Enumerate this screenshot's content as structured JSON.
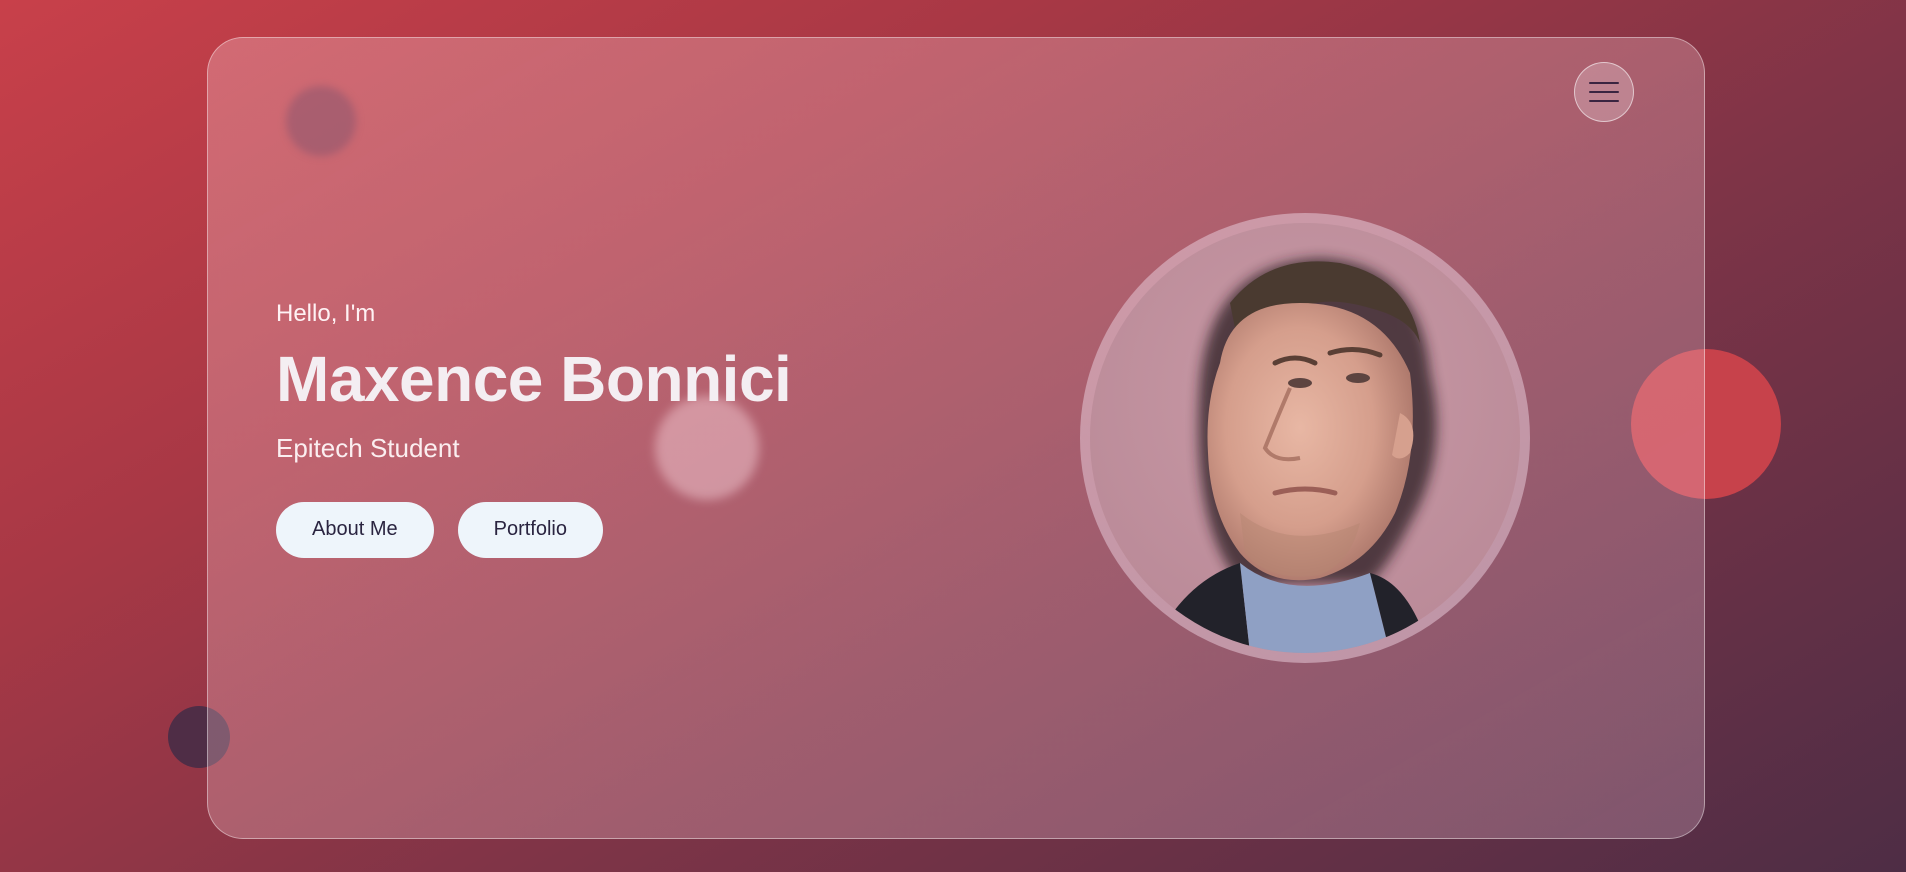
{
  "hero": {
    "greeting": "Hello, I'm",
    "name": "Maxence Bonnici",
    "subtitle": "Epitech Student",
    "buttons": {
      "about_label": "About Me",
      "portfolio_label": "Portfolio"
    }
  },
  "menu": {
    "icon": "hamburger-menu-icon"
  },
  "avatar": {
    "icon": "profile-photo"
  },
  "colors": {
    "background_start": "#c8404a",
    "background_end": "#4e2d45",
    "button_background": "#eef5fb",
    "button_text": "#2a2440",
    "accent_blob": "#c7424b"
  }
}
